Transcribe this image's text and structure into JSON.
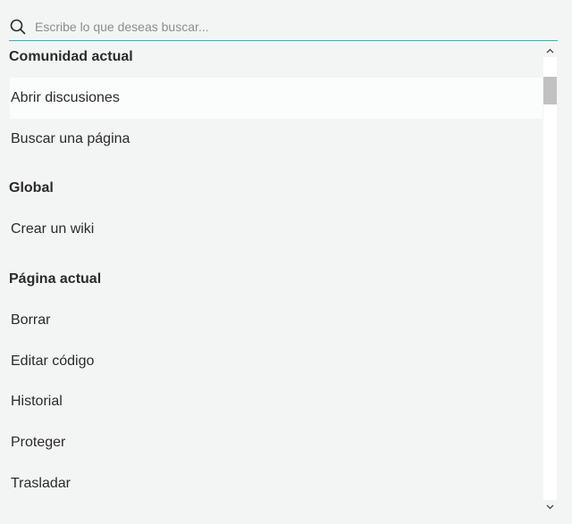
{
  "search": {
    "placeholder": "Escribe lo que deseas buscar...",
    "value": ""
  },
  "sections": [
    {
      "title": "Comunidad actual",
      "items": [
        "Abrir discusiones",
        "Buscar una página"
      ]
    },
    {
      "title": "Global",
      "items": [
        "Crear un wiki"
      ]
    },
    {
      "title": "Página actual",
      "items": [
        "Borrar",
        "Editar código",
        "Historial",
        "Proteger",
        "Trasladar"
      ]
    }
  ],
  "highlighted_item": "Abrir discusiones",
  "icons": {
    "search": "search-icon",
    "scroll_up": "chevron-up-icon",
    "scroll_down": "chevron-down-icon"
  },
  "colors": {
    "accent": "#4aa8b8",
    "background": "#f3f5f4",
    "highlight": "#fbfcfc"
  }
}
